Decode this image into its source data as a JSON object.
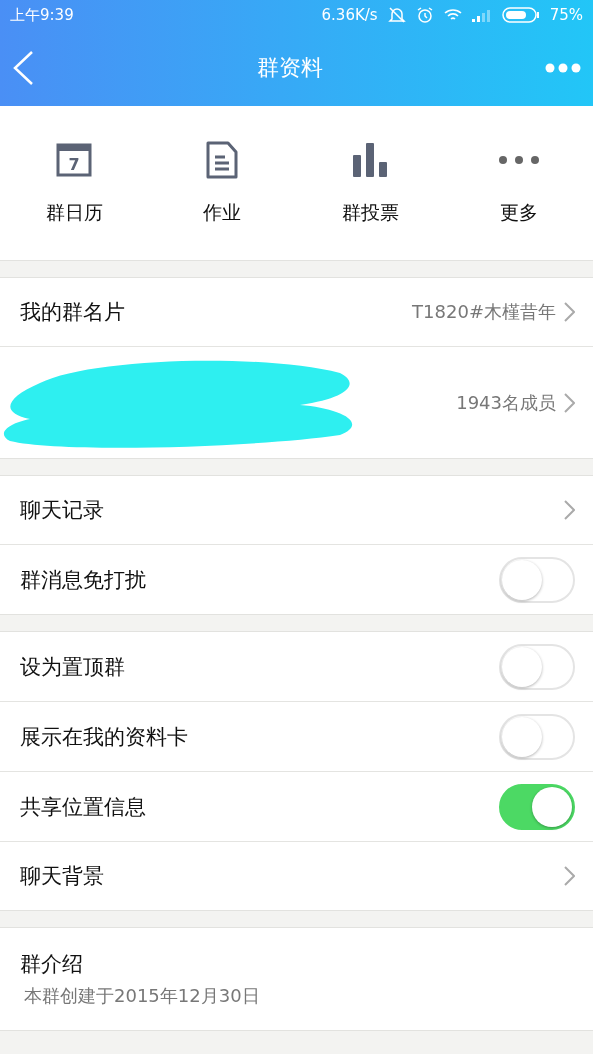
{
  "status_bar": {
    "time": "上午9:39",
    "speed": "6.36K/s",
    "battery": "75%"
  },
  "header": {
    "title": "群资料"
  },
  "quick_actions": [
    {
      "label": "群日历",
      "kind": "calendar",
      "day": "7"
    },
    {
      "label": "作业",
      "kind": "document"
    },
    {
      "label": "群投票",
      "kind": "chart"
    },
    {
      "label": "更多",
      "kind": "more"
    }
  ],
  "groups": [
    {
      "rows": [
        {
          "kind": "link",
          "label": "我的群名片",
          "value": "T1820#木槿昔年"
        },
        {
          "kind": "members",
          "value": "1943名成员"
        }
      ]
    },
    {
      "rows": [
        {
          "kind": "link",
          "label": "聊天记录"
        },
        {
          "kind": "toggle",
          "label": "群消息免打扰",
          "on": false
        }
      ]
    },
    {
      "rows": [
        {
          "kind": "toggle",
          "label": "设为置顶群",
          "on": false
        },
        {
          "kind": "toggle",
          "label": "展示在我的资料卡",
          "on": false
        },
        {
          "kind": "toggle",
          "label": "共享位置信息",
          "on": true
        },
        {
          "kind": "link",
          "label": "聊天背景"
        }
      ]
    },
    {
      "rows": [
        {
          "kind": "intro",
          "label": "群介绍",
          "value": "本群创建于2015年12月30日"
        }
      ]
    }
  ]
}
